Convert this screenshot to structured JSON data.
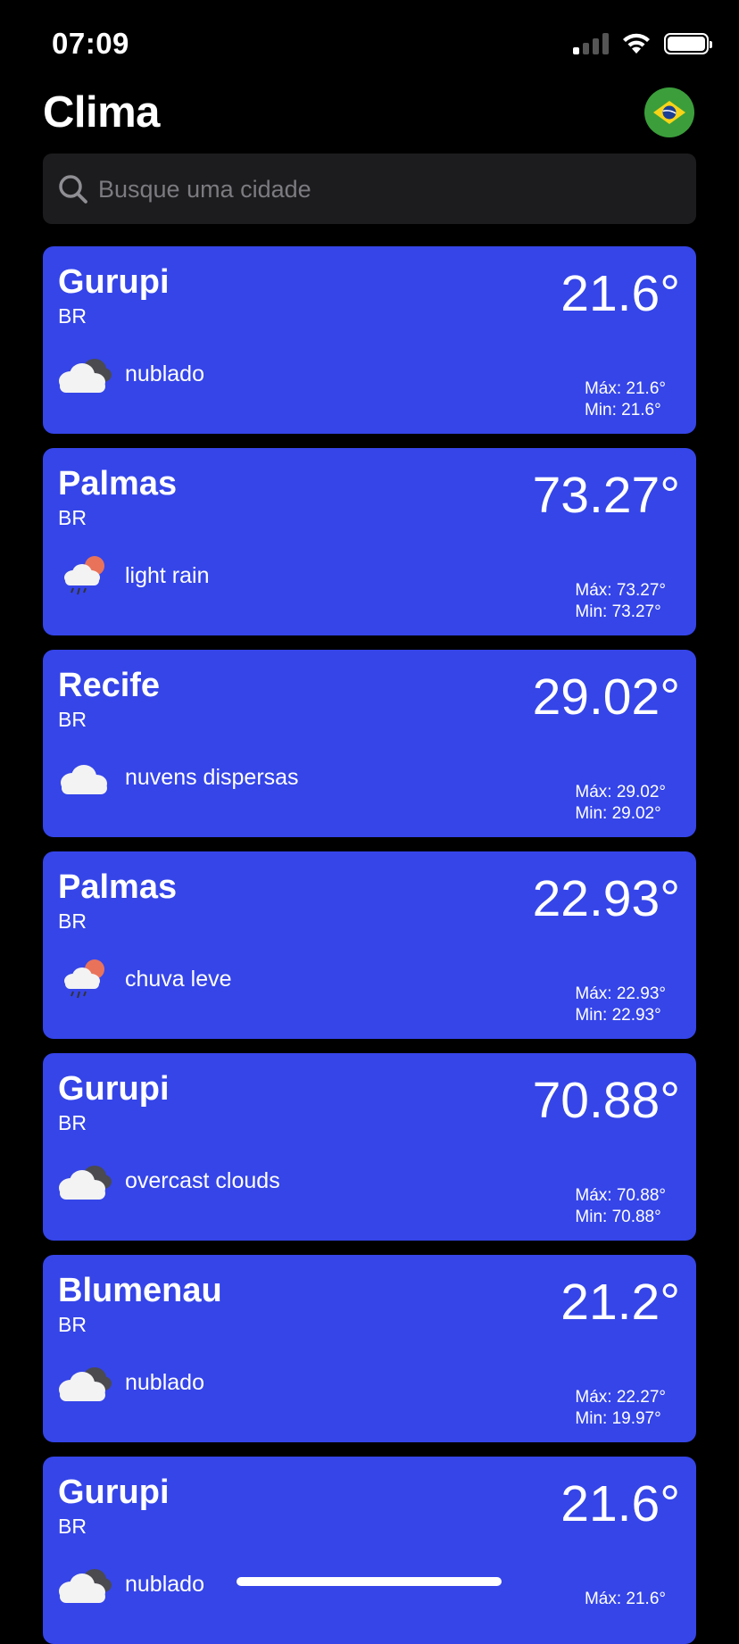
{
  "status_bar": {
    "time": "07:09"
  },
  "header": {
    "title": "Clima"
  },
  "search": {
    "placeholder": "Busque uma cidade"
  },
  "cities": [
    {
      "name": "Gurupi",
      "country": "BR",
      "temp": "21.6°",
      "icon": "overcast-clouds-icon",
      "description": "nublado",
      "max": "Máx: 21.6°",
      "min": "Min: 21.6°"
    },
    {
      "name": "Palmas",
      "country": "BR",
      "temp": "73.27°",
      "icon": "light-rain-icon",
      "description": "light rain",
      "max": "Máx: 73.27°",
      "min": "Min: 73.27°"
    },
    {
      "name": "Recife",
      "country": "BR",
      "temp": "29.02°",
      "icon": "scattered-clouds-icon",
      "description": "nuvens dispersas",
      "max": "Máx: 29.02°",
      "min": "Min: 29.02°"
    },
    {
      "name": "Palmas",
      "country": "BR",
      "temp": "22.93°",
      "icon": "light-rain-icon",
      "description": "chuva leve",
      "max": "Máx: 22.93°",
      "min": "Min: 22.93°"
    },
    {
      "name": "Gurupi",
      "country": "BR",
      "temp": "70.88°",
      "icon": "overcast-clouds-icon",
      "description": "overcast clouds",
      "max": "Máx: 70.88°",
      "min": "Min: 70.88°"
    },
    {
      "name": "Blumenau",
      "country": "BR",
      "temp": "21.2°",
      "icon": "overcast-clouds-icon",
      "description": "nublado",
      "max": "Máx: 22.27°",
      "min": "Min: 19.97°"
    },
    {
      "name": "Gurupi",
      "country": "BR",
      "temp": "21.6°",
      "icon": "overcast-clouds-icon",
      "description": "nublado",
      "max": "Máx: 21.6°",
      "min": ""
    }
  ]
}
